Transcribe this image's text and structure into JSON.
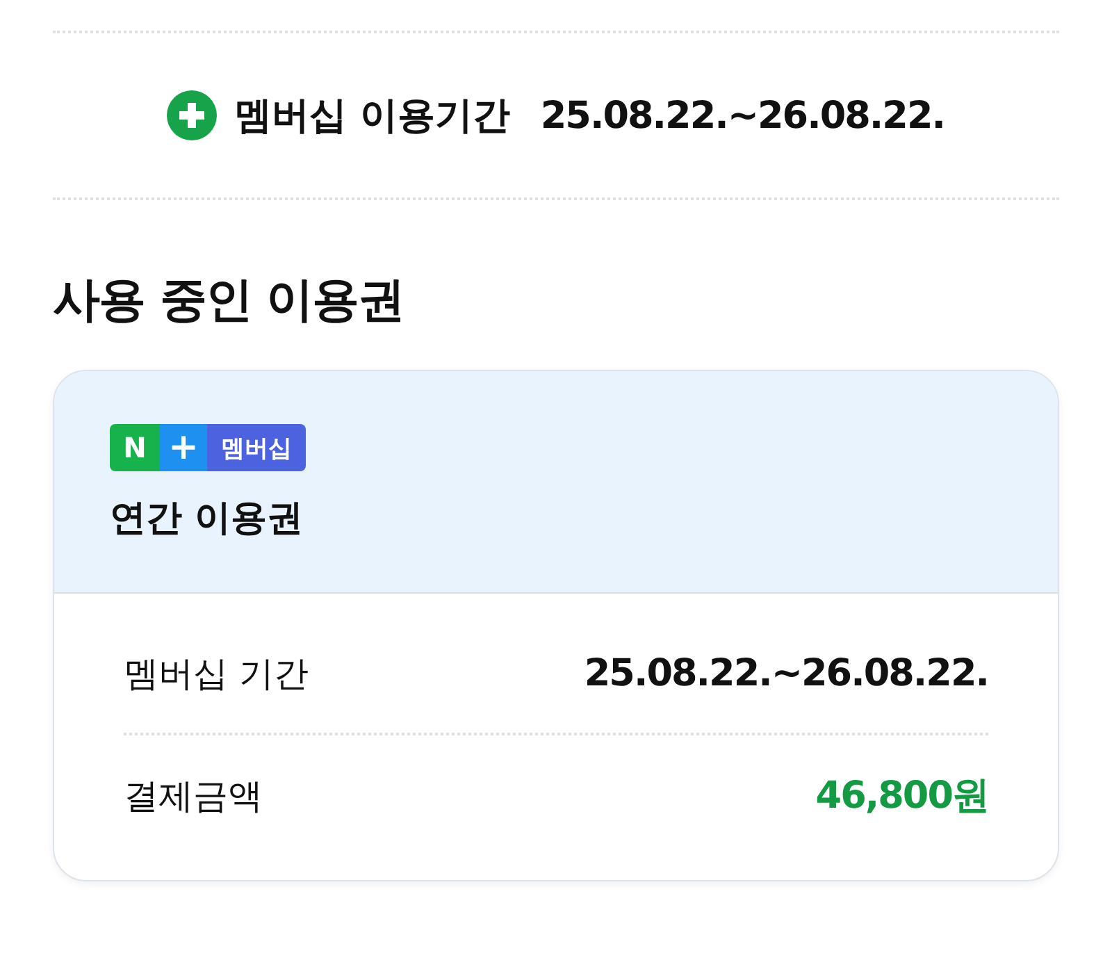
{
  "membership_period": {
    "label": "멤버십 이용기간",
    "value": "25.08.22.~26.08.22."
  },
  "section_title": "사용 중인 이용권",
  "ticket": {
    "badge": {
      "brand": "N",
      "plus": "+",
      "label": "멤버십"
    },
    "name": "연간 이용권",
    "rows": [
      {
        "label": "멤버십 기간",
        "value": "25.08.22.~26.08.22.",
        "kind": "plain"
      },
      {
        "label": "결제금액",
        "value": "46,800원",
        "kind": "price"
      }
    ]
  }
}
